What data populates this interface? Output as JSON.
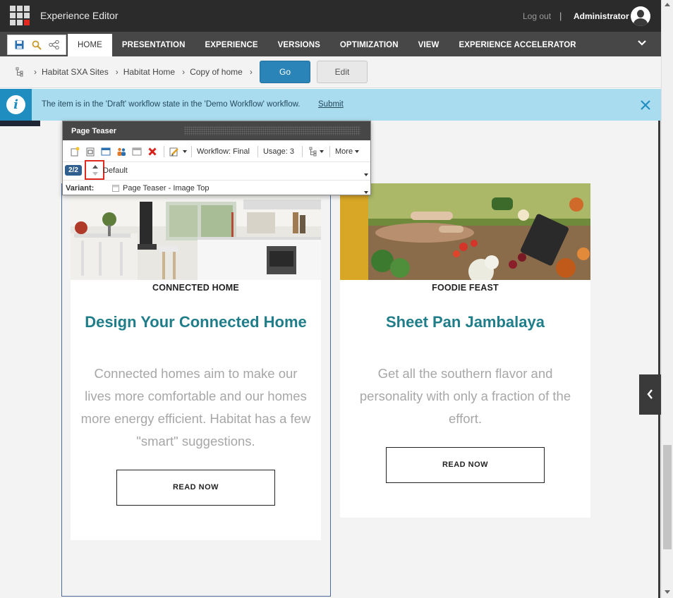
{
  "app": {
    "title": "Experience Editor"
  },
  "header": {
    "logout": "Log out",
    "separator": "|",
    "user": "Administrator"
  },
  "ribbon": {
    "tabs": [
      {
        "label": "HOME",
        "active": true
      },
      {
        "label": "PRESENTATION"
      },
      {
        "label": "EXPERIENCE"
      },
      {
        "label": "VERSIONS"
      },
      {
        "label": "OPTIMIZATION"
      },
      {
        "label": "VIEW"
      },
      {
        "label": "EXPERIENCE ACCELERATOR"
      }
    ],
    "quick_icons": [
      "save-icon",
      "search-icon",
      "share-icon"
    ]
  },
  "breadcrumb": {
    "items": [
      "Habitat SXA Sites",
      "Habitat Home",
      "Copy of home"
    ],
    "arrow": "›",
    "go_label": "Go",
    "edit_label": "Edit"
  },
  "notification": {
    "icon": "i",
    "text": "The item is in the 'Draft' workflow state in the 'Demo Workflow' workflow.",
    "link": "Submit"
  },
  "chrome": {
    "title": "Page Teaser",
    "workflow": "Workflow: Final",
    "usage": "Usage: 3",
    "more": "More",
    "count": "2/2",
    "value": "Default",
    "variant_label": "Variant:",
    "variant_value": "Page Teaser - Image Top"
  },
  "cards": [
    {
      "category": "CONNECTED HOME",
      "title": "Design Your Connected Home",
      "text_lines": [
        "Connected homes aim to make our",
        "lives more comfortable and our homes",
        "more energy efficient. Habitat has a few",
        "\"smart\" suggestions."
      ],
      "button": "READ NOW"
    },
    {
      "category": "FOODIE FEAST",
      "title": "Sheet Pan Jambalaya",
      "text_lines": [
        "Get all the southern flavor and",
        "personality with only a fraction of the",
        "effort."
      ],
      "button": "READ NOW"
    }
  ],
  "colors": {
    "accent": "#2a84b8",
    "title_teal": "#1f7e8a",
    "notify_bg": "#a9dcee",
    "ribbon": "#474747",
    "topbar": "#2b2b2b",
    "highlight": "#e02a1f"
  }
}
